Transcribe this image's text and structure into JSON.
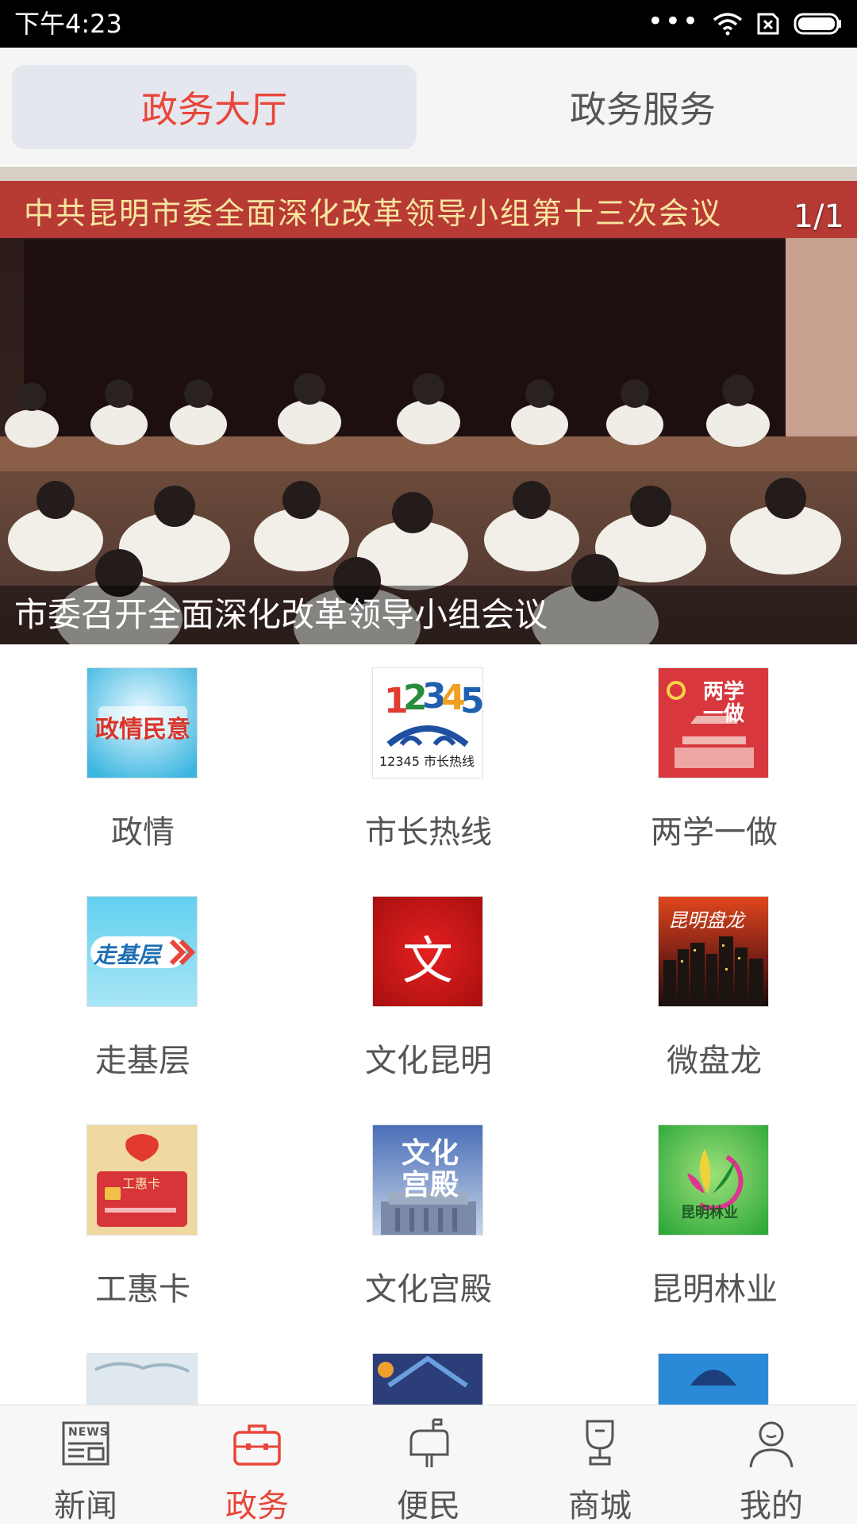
{
  "status_bar": {
    "time": "下午4:23",
    "dots": "•••"
  },
  "tabs": [
    {
      "label": "政务大厅",
      "active": true
    },
    {
      "label": "政务服务",
      "active": false
    }
  ],
  "banner": {
    "sign_text": "中共昆明市委全面深化改革领导小组第十三次会议",
    "counter": "1/1",
    "caption": "市委召开全面深化改革领导小组会议"
  },
  "grid": [
    {
      "label": "政情",
      "icon_text": "政情民意",
      "icon": "zhengqing-minyi-icon"
    },
    {
      "label": "市长热线",
      "icon_text": "12345 市长热线",
      "icon": "mayor-hotline-icon"
    },
    {
      "label": "两学一做",
      "icon_text": "两学一做",
      "icon": "liangxue-yizuo-icon"
    },
    {
      "label": "走基层",
      "icon_text": "走基层",
      "icon": "zou-jiceng-icon"
    },
    {
      "label": "文化昆明",
      "icon_text": "文",
      "icon": "culture-kunming-icon"
    },
    {
      "label": "微盘龙",
      "icon_text": "昆明盘龙",
      "icon": "wei-panlong-icon"
    },
    {
      "label": "工惠卡",
      "icon_text": "工惠卡",
      "icon": "gonghui-card-icon"
    },
    {
      "label": "文化宫殿",
      "icon_text": "文化宫殿",
      "icon": "culture-palace-icon"
    },
    {
      "label": "昆明林业",
      "icon_text": "昆明林业",
      "icon": "kunming-forestry-icon"
    }
  ],
  "bottom_nav": [
    {
      "label": "新闻",
      "icon": "news-icon",
      "active": false,
      "icon_text": "NEWS"
    },
    {
      "label": "政务",
      "icon": "briefcase-icon",
      "active": true
    },
    {
      "label": "便民",
      "icon": "mailbox-icon",
      "active": false
    },
    {
      "label": "商城",
      "icon": "trophy-icon",
      "active": false
    },
    {
      "label": "我的",
      "icon": "user-icon",
      "active": false
    }
  ],
  "colors": {
    "accent": "#e8463a",
    "text_gray": "#555555",
    "nav_bg": "#f7f7f7"
  }
}
